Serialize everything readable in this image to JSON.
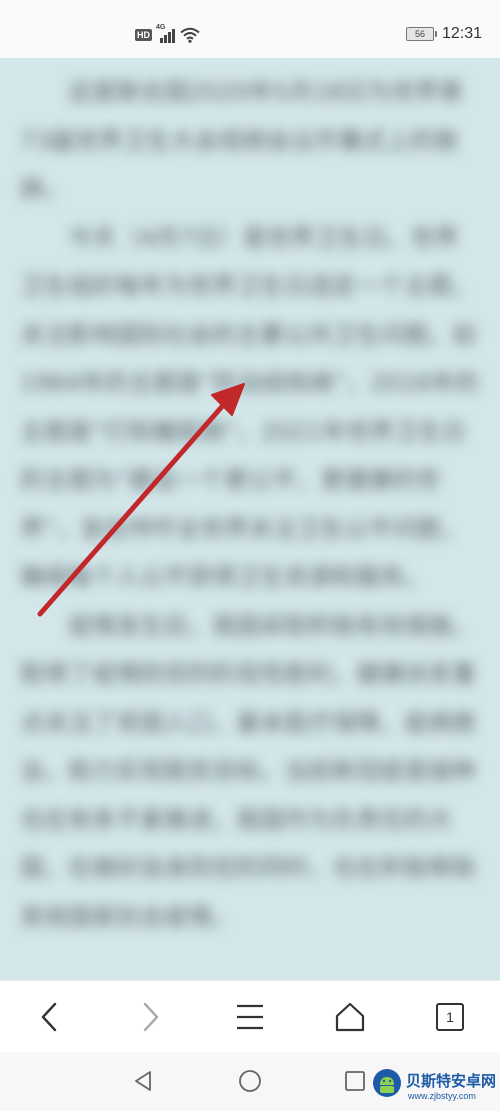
{
  "status_bar": {
    "hd_label": "HD",
    "network_label": "4G",
    "battery_level": "56",
    "time": "12:31"
  },
  "article": {
    "paragraphs": [
      "这是联合国2020年5月18日为世界第73届世界卫生大会视频会议开幕式上的致辞。",
      "今天（4月7日）是世界卫生日。世界卫生组织每年为世界卫生日选定一个主题，关注影响国际社会的主要公共卫生问题。如1964年的主题是“防治结核病”，2016年的主题是“打败糖尿病”，2021年世界卫生日的主题为“建设一个更公平、更健康的世界”，旨在呼吁全世界关注卫生公平问题，确保每个人公平获得卫生资源和服务。",
      "疫情发生后，我国采取积极有效措施，取得了疫情防控的阶段性胜利，健康扶贫重点关注了贫困人口，基本医疗保障、疫病救治，助力实现脱贫目标。当前新冠疫苗接种也在有条不紊推进，我国作为负责任的大国，在做好自身防控的同时，也在积极帮助其他国家抗击疫情。"
    ]
  },
  "toolbar": {
    "back_icon": "chevron-left-icon",
    "forward_icon": "chevron-right-icon",
    "menu_icon": "hamburger-menu-icon",
    "home_icon": "home-icon",
    "tab_count": "1"
  },
  "system_nav": {
    "back_icon": "triangle-back-icon",
    "home_icon": "circle-home-icon",
    "recents_icon": "square-recents-icon"
  },
  "watermark": {
    "name": "贝斯特安卓网",
    "url": "www.zjbstyy.com"
  },
  "colors": {
    "content_background": "#d3e6ea",
    "arrow": "#c0282a",
    "watermark": "#1d5aa8"
  }
}
